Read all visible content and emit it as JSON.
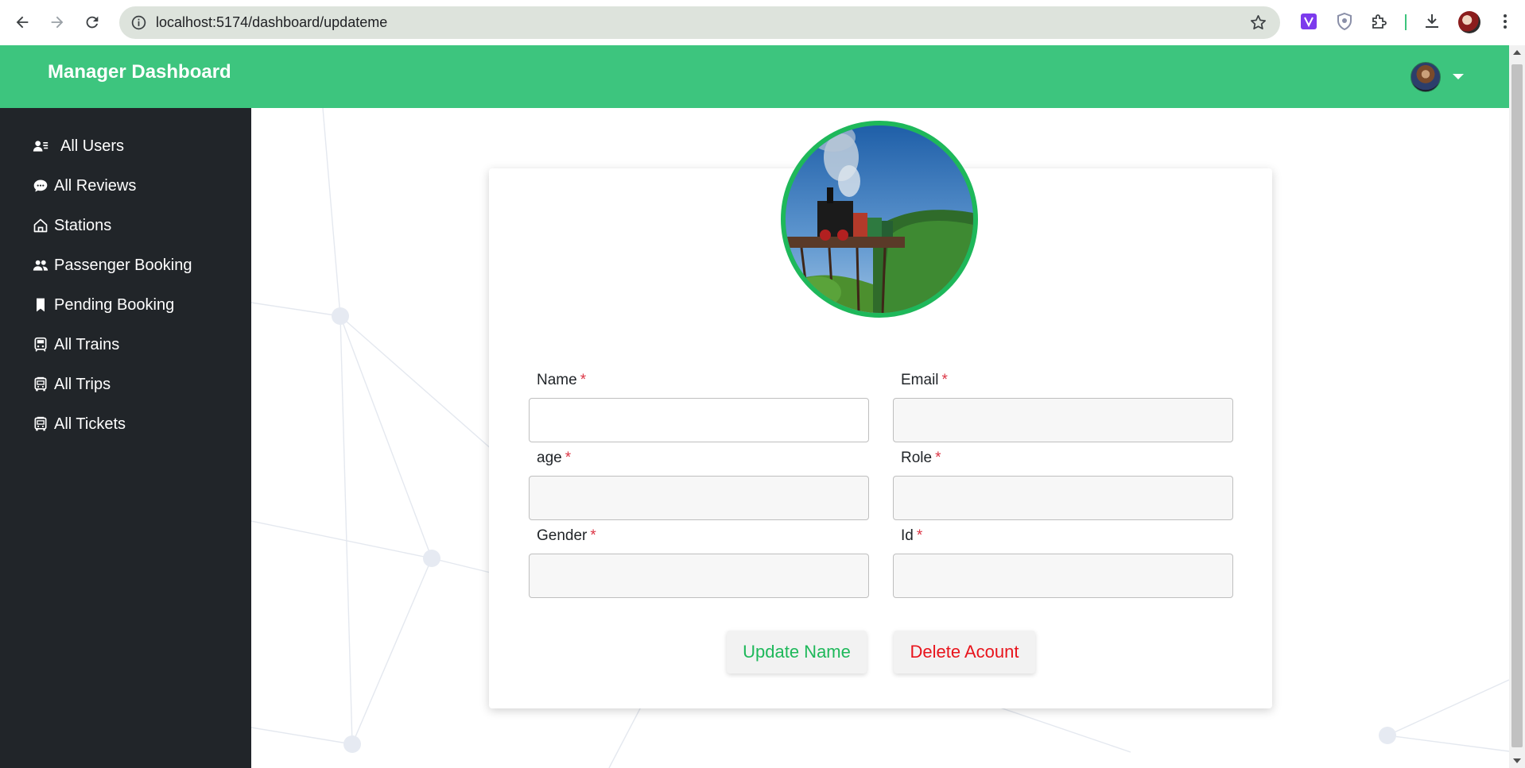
{
  "browser": {
    "url": "localhost:5174/dashboard/updateme",
    "back_icon": "arrow-left",
    "forward_icon": "arrow-right",
    "reload_icon": "reload",
    "site_info_icon": "info-circle",
    "bookmark_icon": "star",
    "extensions": [
      "vue-devtools",
      "shield",
      "puzzle-piece"
    ],
    "download_icon": "download",
    "menu_icon": "vertical-dots"
  },
  "header": {
    "title": "Manager Dashboard",
    "avatar_icon": "user-avatar",
    "dropdown_icon": "caret-down",
    "color": "#3dc57e"
  },
  "sidebar": {
    "background": "#212529",
    "items": [
      {
        "label": "All Users",
        "icon": "users-list-icon"
      },
      {
        "label": "All Reviews",
        "icon": "chat-icon"
      },
      {
        "label": "Stations",
        "icon": "house-icon"
      },
      {
        "label": "Passenger Booking",
        "icon": "people-icon"
      },
      {
        "label": "Pending Booking",
        "icon": "bookmark-icon"
      },
      {
        "label": "All Trains",
        "icon": "train-icon"
      },
      {
        "label": "All Trips",
        "icon": "bus-icon"
      },
      {
        "label": "All Tickets",
        "icon": "bus-icon"
      }
    ]
  },
  "profile": {
    "image": "steam-train-on-bridge",
    "border_color": "#1eb85a"
  },
  "form": {
    "fields": [
      {
        "label": "Name",
        "required": "*",
        "value": ""
      },
      {
        "label": "Email",
        "required": "*",
        "value": ""
      },
      {
        "label": "age",
        "required": "*",
        "value": ""
      },
      {
        "label": "Role",
        "required": "*",
        "value": ""
      },
      {
        "label": "Gender",
        "required": "*",
        "value": ""
      },
      {
        "label": "Id",
        "required": "*",
        "value": ""
      }
    ],
    "update_button": "Update Name",
    "delete_button": "Delete Acount"
  }
}
